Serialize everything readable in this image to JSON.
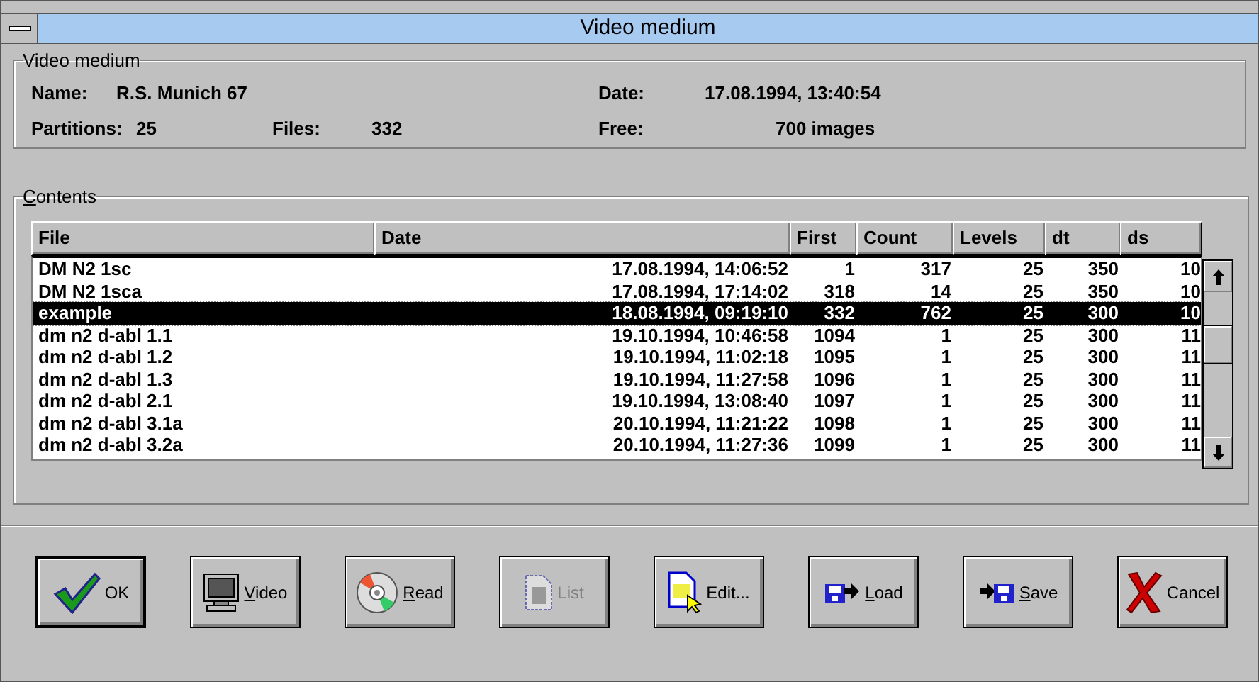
{
  "window": {
    "title": "Video medium"
  },
  "medium": {
    "title": "Video medium",
    "fields": [
      {
        "label": "Name:",
        "value": "R.S. Munich 67"
      },
      {
        "label": "Date:",
        "value": "17.08.1994, 13:40:54"
      },
      {
        "label": "Partitions:",
        "value": "25"
      },
      {
        "label": "Files:",
        "value": "332"
      },
      {
        "label": "Free:",
        "value": "700  images"
      }
    ]
  },
  "contents": {
    "title": "Contents",
    "underline_first": true,
    "columns": [
      "File",
      "Date",
      "First",
      "Count",
      "Levels",
      "dt",
      "ds"
    ],
    "rows": [
      {
        "cells": [
          "DM N2 1sc",
          "17.08.1994, 14:06:52",
          "1",
          "317",
          "25",
          "350",
          "10"
        ],
        "selected": false
      },
      {
        "cells": [
          "DM N2 1sca",
          "17.08.1994, 17:14:02",
          "318",
          "14",
          "25",
          "350",
          "10"
        ],
        "selected": false
      },
      {
        "cells": [
          "example",
          "18.08.1994, 09:19:10",
          "332",
          "762",
          "25",
          "300",
          "10"
        ],
        "selected": true
      },
      {
        "cells": [
          "dm n2 d-abl 1.1",
          "19.10.1994, 10:46:58",
          "1094",
          "1",
          "25",
          "300",
          "11"
        ],
        "selected": false
      },
      {
        "cells": [
          "dm n2 d-abl 1.2",
          "19.10.1994, 11:02:18",
          "1095",
          "1",
          "25",
          "300",
          "11"
        ],
        "selected": false
      },
      {
        "cells": [
          "dm n2 d-abl 1.3",
          "19.10.1994, 11:27:58",
          "1096",
          "1",
          "25",
          "300",
          "11"
        ],
        "selected": false
      },
      {
        "cells": [
          "dm n2 d-abl 2.1",
          "19.10.1994, 13:08:40",
          "1097",
          "1",
          "25",
          "300",
          "11"
        ],
        "selected": false
      },
      {
        "cells": [
          "dm n2 d-abl 3.1a",
          "20.10.1994, 11:21:22",
          "1098",
          "1",
          "25",
          "300",
          "11"
        ],
        "selected": false
      },
      {
        "cells": [
          "dm n2 d-abl 3.2a",
          "20.10.1994, 11:27:36",
          "1099",
          "1",
          "25",
          "300",
          "11"
        ],
        "selected": false
      }
    ]
  },
  "buttons": [
    {
      "kind": "ok",
      "label": "OK",
      "default": true,
      "disabled": false,
      "underline_first": false
    },
    {
      "kind": "video",
      "label": "Video",
      "default": false,
      "disabled": false,
      "underline_first": true
    },
    {
      "kind": "read",
      "label": "Read",
      "default": false,
      "disabled": false,
      "underline_first": true
    },
    {
      "kind": "list",
      "label": "List",
      "default": false,
      "disabled": true,
      "underline_first": false
    },
    {
      "kind": "edit",
      "label": "Edit...",
      "default": false,
      "disabled": false,
      "underline_first": false
    },
    {
      "kind": "load",
      "label": "Load",
      "default": false,
      "disabled": false,
      "underline_first": true
    },
    {
      "kind": "save",
      "label": "Save",
      "default": false,
      "disabled": false,
      "underline_first": true
    },
    {
      "kind": "cancel",
      "label": "Cancel",
      "default": false,
      "disabled": false,
      "underline_first": false
    }
  ]
}
